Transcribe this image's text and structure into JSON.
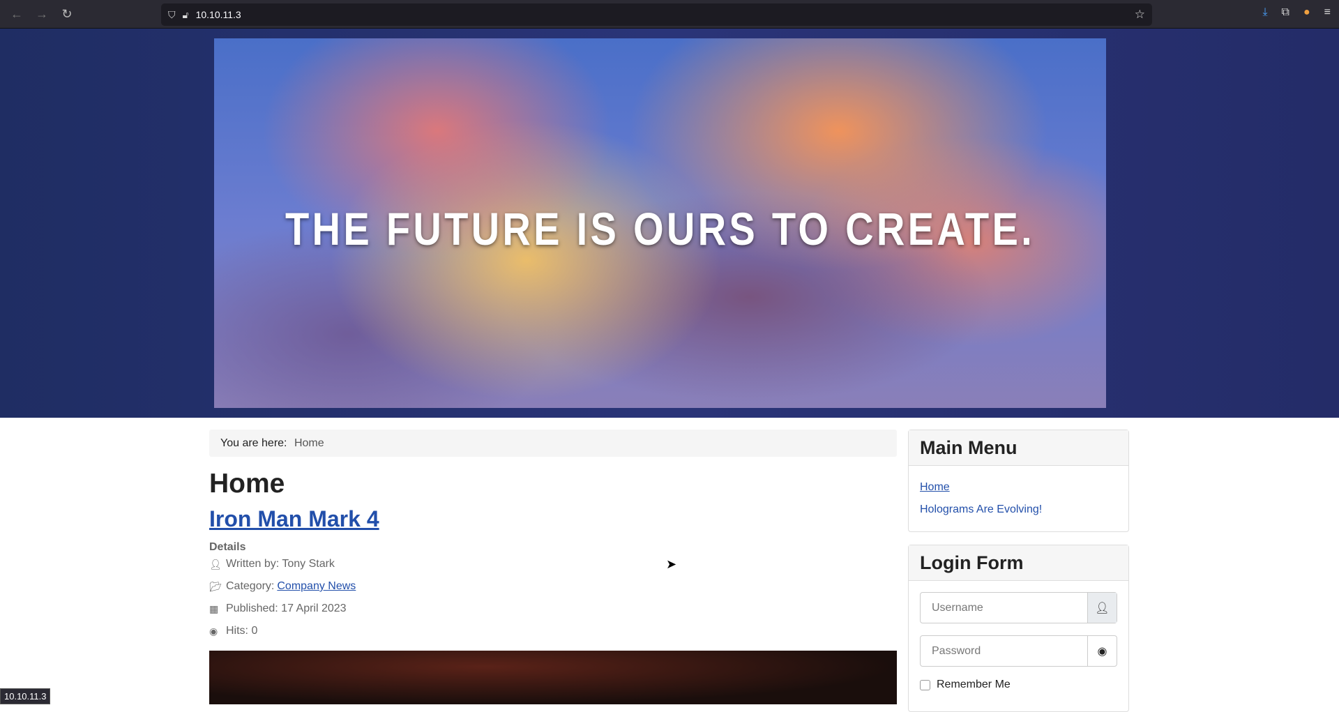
{
  "browser": {
    "url": "10.10.11.3",
    "status_url": "10.10.11.3",
    "icons": [
      "back-icon",
      "forward-icon",
      "reload-icon",
      "shield-icon",
      "lock-icon",
      "star-icon",
      "download-icon",
      "extensions-icon",
      "profile-icon",
      "menu-icon"
    ]
  },
  "banner": {
    "slogan": "THE FUTURE IS OURS TO CREATE."
  },
  "breadcrumb": {
    "label": "You are here:",
    "current": "Home"
  },
  "page": {
    "title": "Home"
  },
  "article": {
    "title": "Iron Man Mark 4",
    "details_label": "Details",
    "written_by": "Written by: Tony Stark",
    "category_label": "Category:",
    "category": "Company News",
    "published": "Published: 17 April 2023",
    "hits": "Hits: 0"
  },
  "main_menu": {
    "title": "Main Menu",
    "items": [
      {
        "label": "Home"
      },
      {
        "label": "Holograms Are Evolving!"
      }
    ]
  },
  "login": {
    "title": "Login Form",
    "username_placeholder": "Username",
    "password_placeholder": "Password",
    "remember": "Remember Me"
  },
  "colors": {
    "link": "#224faa",
    "header_bg": "#26306e"
  }
}
